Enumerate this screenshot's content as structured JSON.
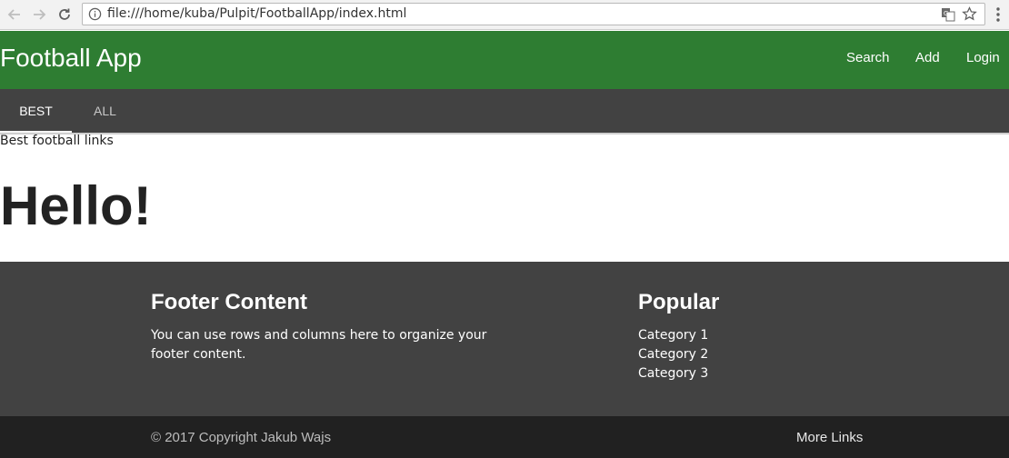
{
  "browser": {
    "url": "file:///home/kuba/Pulpit/FootballApp/index.html",
    "icons": [
      "back-arrow-icon",
      "forward-arrow-icon",
      "reload-icon",
      "info-icon",
      "translate-icon",
      "star-icon",
      "menu-dots-icon"
    ]
  },
  "header": {
    "brand": "Football App",
    "nav": [
      "Search",
      "Add",
      "Login"
    ],
    "color": "#2e7d32"
  },
  "tabs": {
    "items": [
      "BEST",
      "ALL"
    ],
    "active": "BEST",
    "color": "#424242"
  },
  "main": {
    "subtitle": "Best football links",
    "heading": "Hello!"
  },
  "footer": {
    "content_title": "Footer Content",
    "content_text": "You can use rows and columns here to organize your footer content.",
    "popular_title": "Popular",
    "popular_items": [
      "Category 1",
      "Category 2",
      "Category 3"
    ],
    "copyright": "© 2017 Copyright Jakub Wajs",
    "more_links": "More Links",
    "color": "#424242",
    "bottom_color": "#212121"
  }
}
